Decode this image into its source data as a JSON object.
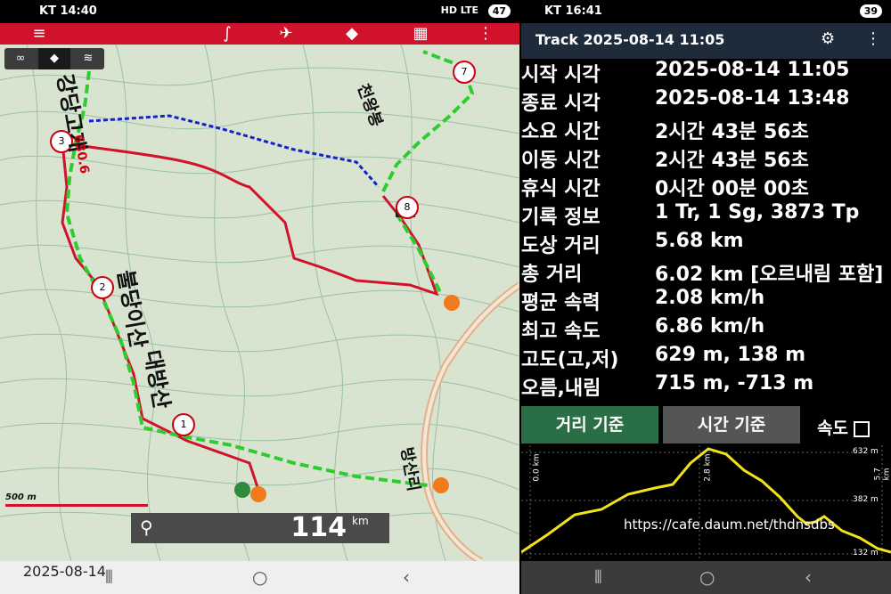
{
  "left": {
    "status": {
      "carrier_time": "KT 14:40",
      "net": "HD LTE",
      "battery": "47"
    },
    "toolbar_icons": [
      "menu-icon",
      "route-icon",
      "pin-icon",
      "direction-icon",
      "map-icon",
      "more-icon"
    ],
    "map": {
      "ridge_label_1": "대방산",
      "ridge_label_2": "불당이산",
      "ridge_label_3": "강당고개",
      "summit_label": "천왕봉",
      "road_label": "방산리",
      "elev_label": "630.6",
      "waypoints": [
        "1",
        "2",
        "3",
        "7",
        "8"
      ],
      "scale": "500 m",
      "odometer": "114",
      "odometer_unit": "km"
    },
    "date_stamp": "2025-08-14"
  },
  "right": {
    "status": {
      "carrier_time": "KT 16:41",
      "battery": "39"
    },
    "title": "Track 2025-08-14 11:05",
    "stats": [
      {
        "label": "시작 시각",
        "value": "2025-08-14 11:05"
      },
      {
        "label": "종료 시각",
        "value": "2025-08-14 13:48"
      },
      {
        "label": "소요 시간",
        "value": "2시간 43분 56초"
      },
      {
        "label": "이동 시간",
        "value": "2시간 43분 56초"
      },
      {
        "label": "휴식 시간",
        "value": "0시간 00분 00초"
      },
      {
        "label": "기록 정보",
        "value": "1 Tr, 1 Sg, 3873 Tp"
      },
      {
        "label": "도상 거리",
        "value": "5.68 km"
      },
      {
        "label": "총 거리",
        "value": "6.02 km [오르내림 포함]"
      },
      {
        "label": "평균 속력",
        "value": "2.08 km/h"
      },
      {
        "label": "최고 속도",
        "value": "6.86 km/h"
      },
      {
        "label": "고도(고,저)",
        "value": "629 m, 138 m"
      },
      {
        "label": "오름,내림",
        "value": "715 m, -713 m"
      }
    ],
    "btn_distance": "거리 기준",
    "btn_time": "시간 기준",
    "speed_label": "속도",
    "chart": {
      "x0": "0.0 km",
      "xmid": "2.8 km",
      "xend": "5.7 km",
      "ytop": "632 m",
      "ymid": "382 m",
      "ybot": "132 m"
    },
    "watermark": "https://cafe.daum.net/thdnsdbs"
  }
}
